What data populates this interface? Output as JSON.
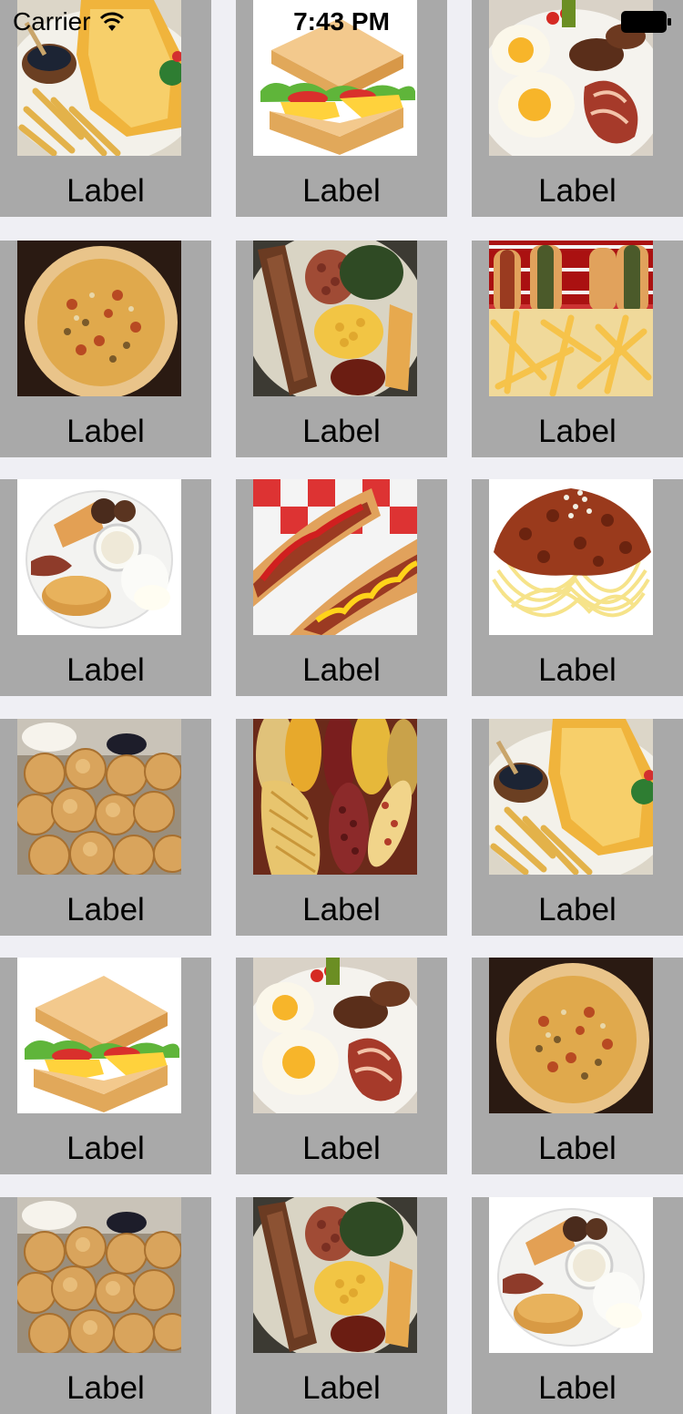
{
  "status_bar": {
    "carrier": "Carrier",
    "time": "7:43 PM"
  },
  "grid": {
    "items": [
      {
        "label": "Label",
        "image": "fish-and-chips"
      },
      {
        "label": "Label",
        "image": "sandwich"
      },
      {
        "label": "Label",
        "image": "breakfast-plate-eggs-sausage"
      },
      {
        "label": "Label",
        "image": "pizza"
      },
      {
        "label": "Label",
        "image": "bbq-plate-mac-and-cheese"
      },
      {
        "label": "Label",
        "image": "hot-dogs-and-fries"
      },
      {
        "label": "Label",
        "image": "pancake-breakfast-plate"
      },
      {
        "label": "Label",
        "image": "hot-dogs-ketchup-mustard"
      },
      {
        "label": "Label",
        "image": "spaghetti-bolognese"
      },
      {
        "label": "Label",
        "image": "fritters"
      },
      {
        "label": "Label",
        "image": "corn-cobs"
      },
      {
        "label": "Label",
        "image": "fish-and-chips"
      },
      {
        "label": "Label",
        "image": "sandwich"
      },
      {
        "label": "Label",
        "image": "breakfast-plate-eggs-sausage"
      },
      {
        "label": "Label",
        "image": "pizza"
      },
      {
        "label": "Label",
        "image": "fritters"
      },
      {
        "label": "Label",
        "image": "bbq-plate-mac-and-cheese"
      },
      {
        "label": "Label",
        "image": "pancake-breakfast-plate"
      }
    ]
  },
  "colors": {
    "background": "#efeff4",
    "cell": "#a9a9a9"
  }
}
